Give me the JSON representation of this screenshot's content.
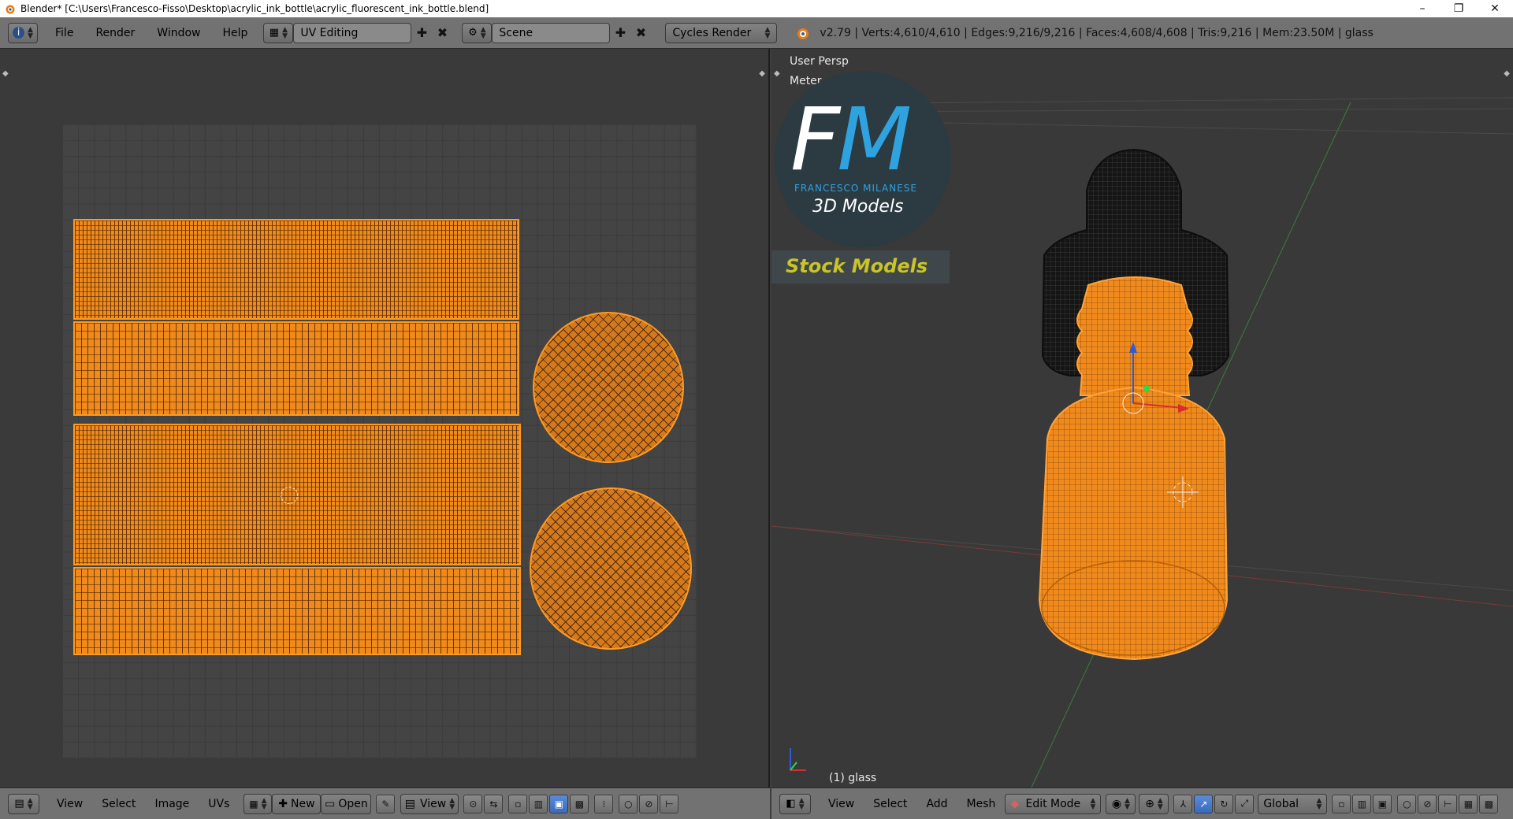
{
  "window": {
    "title": "Blender* [C:\\Users\\Francesco-Fisso\\Desktop\\acrylic_ink_bottle\\acrylic_fluorescent_ink_bottle.blend]",
    "buttons": [
      "–",
      "❐",
      "✕"
    ]
  },
  "info_header": {
    "menus": [
      "File",
      "Render",
      "Window",
      "Help"
    ],
    "screen_layout": "UV Editing",
    "scene": "Scene",
    "render_engine": "Cycles Render",
    "stats": "v2.79 | Verts:4,610/4,610 | Edges:9,216/9,216 | Faces:4,608/4,608 | Tris:9,216 | Mem:23.50M | glass"
  },
  "viewport": {
    "view_name": "User Persp",
    "units": "Meter",
    "object_label": "(1) glass",
    "logo": {
      "letter_f": "F",
      "letter_m": "M",
      "name": "FRANCESCO MILANESE",
      "subtitle": "3D Models",
      "tagline": "Stock Models"
    },
    "colors": {
      "mesh": "#f08a1c",
      "cap": "#1b1b1b",
      "background": "#393939"
    }
  },
  "uv_header": {
    "menus": [
      "View",
      "Select",
      "Image",
      "UVs"
    ],
    "new_label": "New",
    "open_label": "Open",
    "view_label": "View"
  },
  "vp_header": {
    "menus": [
      "View",
      "Select",
      "Add",
      "Mesh"
    ],
    "mode": "Edit Mode",
    "orientation": "Global"
  }
}
